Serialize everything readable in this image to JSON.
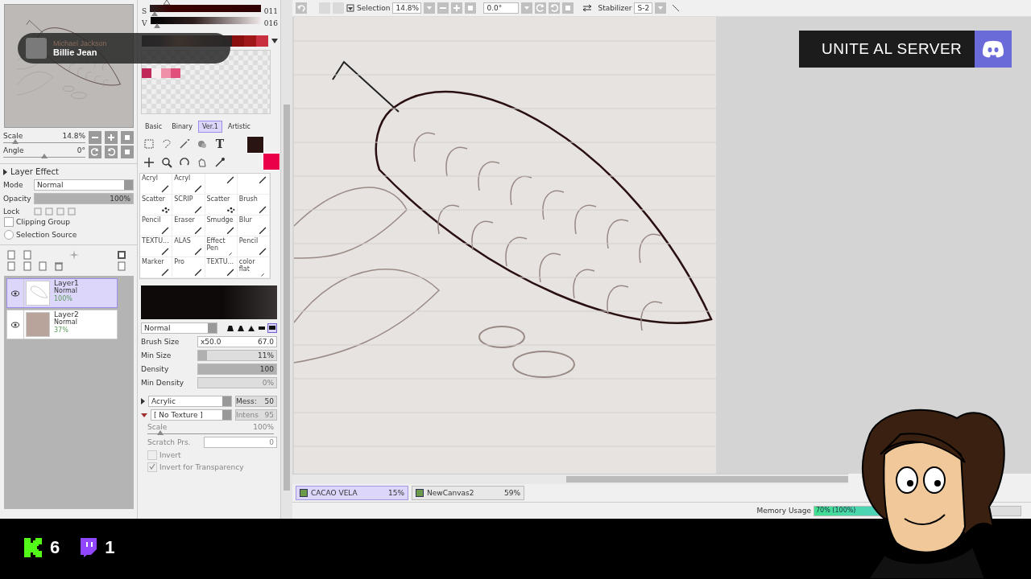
{
  "toolbar": {
    "selection_label": "Selection",
    "zoom": "14.8%",
    "angle": "0.0°",
    "stabilizer_label": "Stabilizer",
    "stabilizer": "S-2"
  },
  "navigator": {
    "scale": {
      "label": "Scale",
      "value": "14.8%",
      "level": 0.15
    },
    "angle": {
      "label": "Angle",
      "value": "0°",
      "level": 0.5
    }
  },
  "layer_panel": {
    "section": "Layer Effect",
    "expanded": false,
    "mode_label": "Mode",
    "mode": "Normal",
    "opacity": {
      "label": "Opacity",
      "value": "100%",
      "level": 1
    },
    "lock_label": "Lock",
    "options": [
      {
        "kind": "checkbox",
        "label": "Clipping Group",
        "checked": false
      },
      {
        "kind": "radio",
        "label": "Selection Source",
        "checked": false
      }
    ],
    "layers": [
      {
        "name": "Layer1",
        "mode": "Normal",
        "opacity": "100%",
        "selected": true,
        "kind": "lines"
      },
      {
        "name": "Layer2",
        "mode": "Normal",
        "opacity": "37%",
        "selected": false,
        "kind": "photo"
      }
    ]
  },
  "color_panel": {
    "sliders": [
      {
        "label": "S",
        "value": "011",
        "level": 0.04
      },
      {
        "label": "V",
        "value": "016",
        "level": 0.06
      }
    ],
    "strip": [
      {
        "color": "#8a1010"
      },
      {
        "color": "#a01818"
      },
      {
        "color": "#c83040"
      }
    ],
    "swatches": [
      {
        "color": "#c0285a"
      },
      {
        "color": "#f8eef0"
      },
      {
        "color": "#f090a8"
      },
      {
        "color": "#e0507a"
      }
    ],
    "tabs": [
      {
        "label": "Basic",
        "selected": false
      },
      {
        "label": "Binary",
        "selected": false
      },
      {
        "label": "Ver.1",
        "selected": true
      },
      {
        "label": "Artistic",
        "selected": false
      }
    ],
    "text_tool": "T",
    "colors": [
      {
        "kind": "primary",
        "color": "#2a1412"
      },
      {
        "kind": "secondary",
        "color": "#ea0048"
      }
    ]
  },
  "brushes": [
    {
      "label": "Acryl",
      "selected": false
    },
    {
      "label": "Acryl",
      "selected": false
    },
    {
      "selected": false
    },
    {
      "selected": false
    },
    {
      "label": "Scatter",
      "selected": false
    },
    {
      "label": "SCRIP",
      "selected": false
    },
    {
      "label": "Scatter",
      "selected": false
    },
    {
      "label": "Brush",
      "selected": false
    },
    {
      "label": "Pencil",
      "selected": false
    },
    {
      "label": "Eraser",
      "selected": false
    },
    {
      "label": "Smudge",
      "selected": false
    },
    {
      "label": "Blur",
      "selected": false
    },
    {
      "label": "TEXTU...",
      "selected": false
    },
    {
      "label": "ALAS",
      "selected": false
    },
    {
      "label": "Effect Pen",
      "selected": false
    },
    {
      "label": "Pencil",
      "selected": false
    },
    {
      "label": "Marker",
      "selected": false
    },
    {
      "label": "Pro",
      "selected": false
    },
    {
      "label": "TEXTU...",
      "selected": false
    },
    {
      "label": "color flat",
      "selected": false
    }
  ],
  "brush_settings": {
    "blend": "Normal",
    "shapes": [
      {
        "selected": false
      },
      {
        "selected": false
      },
      {
        "selected": false
      },
      {
        "selected": false
      },
      {
        "selected": true
      }
    ],
    "size_label": "Brush Size",
    "size_mult": "x50.0",
    "size": "67.0",
    "min_size": {
      "label": "Min Size",
      "value": "11%",
      "level": 0.11
    },
    "density": {
      "label": "Density",
      "value": "100",
      "level": 1
    },
    "min_density": {
      "label": "Min Density",
      "value": "0%",
      "level": 0
    },
    "mixing": "Acrylic",
    "mess_label": "Mess:",
    "mess": "50",
    "texture": "[ No Texture ]",
    "intens_label": "Intens",
    "intens": "95",
    "texture_scale": {
      "label": "Scale",
      "value": "100%",
      "level": 0.1
    },
    "scratch_label": "Scratch Prs.",
    "scratch": "0",
    "checks": [
      {
        "label": "Invert",
        "checked": false,
        "disabled": true
      },
      {
        "label": "Invert for Transparency",
        "checked": true,
        "disabled": true
      }
    ]
  },
  "documents": [
    {
      "name": "CACAO VELA",
      "zoom": "15%",
      "selected": true
    },
    {
      "name": "NewCanvas2",
      "zoom": "59%",
      "selected": false
    }
  ],
  "status_bar": {
    "memory_label": "Memory Usage",
    "memory": "70% (100%)",
    "level": 0.7
  },
  "now_playing": {
    "artist": "Michael Jackson",
    "title": "Billie Jean"
  },
  "banner": {
    "text": "UNITE AL SERVER"
  },
  "counters": [
    {
      "kind": "kick",
      "count": "6"
    },
    {
      "kind": "twitch",
      "count": "1"
    }
  ]
}
